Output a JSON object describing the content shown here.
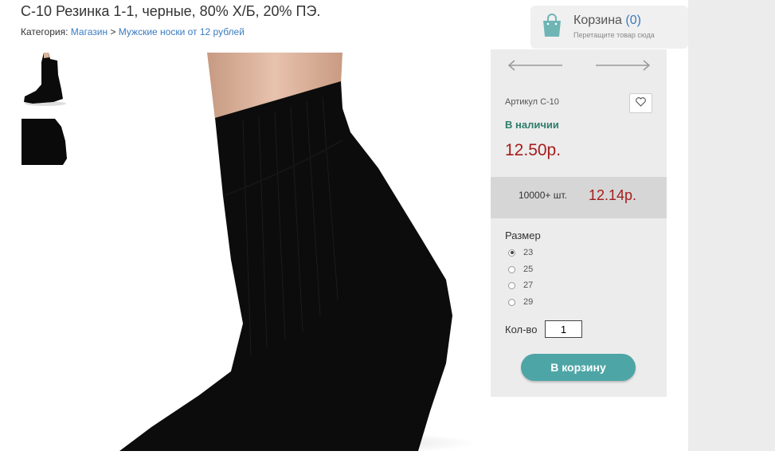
{
  "product": {
    "title": "С-10 Резинка 1-1, черные, 80% Х/Б, 20% ПЭ.",
    "sku": "Артикул С-10",
    "availability": "В наличии",
    "price": "12.50р.",
    "bulk_qty": "10000+ шт.",
    "bulk_price": "12.14р."
  },
  "breadcrumb": {
    "label": "Категория:",
    "items": [
      "Магазин",
      "Мужские носки от 12 рублей"
    ],
    "separator": ">"
  },
  "cart": {
    "title": "Корзина",
    "count": "(0)",
    "hint": "Перетащите товар сюда",
    "icon": "shopping-bag-icon"
  },
  "options": {
    "size_label": "Размер",
    "sizes": [
      "23",
      "25",
      "27",
      "29"
    ],
    "selected_size": "23"
  },
  "quantity": {
    "label": "Кол-во",
    "value": "1"
  },
  "buy_button": "В корзину",
  "colors": {
    "accent": "#4ea5a6",
    "price": "#a51c1c",
    "stock": "#2e7d6b",
    "link": "#3a7bbf"
  }
}
